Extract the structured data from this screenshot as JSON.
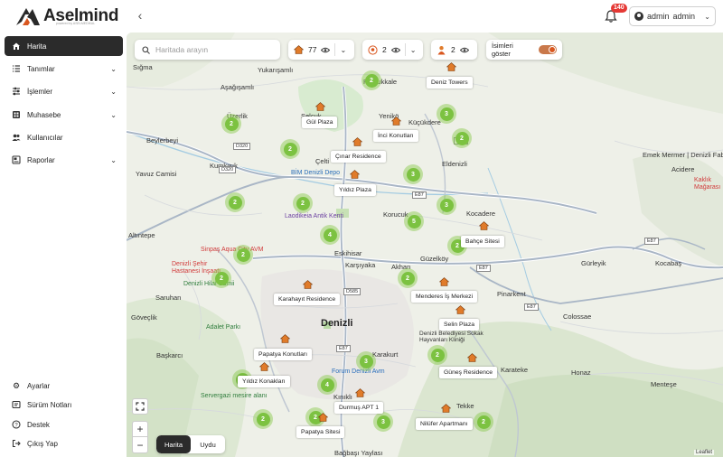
{
  "brand": {
    "name": "Aselmind",
    "sub": "powered by ASELMEDİKAL"
  },
  "header": {
    "notification_count": "140",
    "user_first": "admin",
    "user_last": "admin"
  },
  "sidebar": {
    "items": [
      {
        "label": "Harita",
        "icon": "home-icon",
        "active": true
      },
      {
        "label": "Tanımlar",
        "icon": "list-icon",
        "has_children": true
      },
      {
        "label": "İşlemler",
        "icon": "sliders-icon",
        "has_children": true
      },
      {
        "label": "Muhasebe",
        "icon": "calculator-icon",
        "has_children": true
      },
      {
        "label": "Kullanıcılar",
        "icon": "users-icon"
      },
      {
        "label": "Raporlar",
        "icon": "report-icon",
        "has_children": true
      }
    ],
    "bottom_items": [
      {
        "label": "Ayarlar",
        "icon": "gear-icon"
      },
      {
        "label": "Sürüm Notları",
        "icon": "notes-icon"
      },
      {
        "label": "Destek",
        "icon": "help-icon"
      },
      {
        "label": "Çıkış Yap",
        "icon": "logout-icon"
      }
    ]
  },
  "map": {
    "search_placeholder": "Haritada arayın",
    "filters": [
      {
        "count": "77",
        "icon": "house-icon"
      },
      {
        "count": "2",
        "icon": "pin-badge-icon"
      },
      {
        "count": "2",
        "icon": "person-icon"
      }
    ],
    "toggle_label": "İsimleri göster",
    "layers": [
      "Harita",
      "Uydu"
    ],
    "attribution": "Leaflet",
    "places": [
      {
        "text": "Sığma"
      },
      {
        "text": "Yukarışamlı"
      },
      {
        "text": "Aşağışamlı"
      },
      {
        "text": "Pamukkale"
      },
      {
        "text": "Üzerlik"
      },
      {
        "text": "Beylerbeyi"
      },
      {
        "text": "Yenikö"
      },
      {
        "text": "Küçükdere"
      },
      {
        "text": "Selçuk"
      },
      {
        "text": "Kumkısık"
      },
      {
        "text": "Çelti"
      },
      {
        "text": "Eldenizli"
      },
      {
        "text": "Emek Mermer | Denizli Fabrika"
      },
      {
        "text": "Acidere"
      },
      {
        "text": "Altıntepe"
      },
      {
        "text": "Korucuk"
      },
      {
        "text": "Kocadere"
      },
      {
        "text": "Eskihisar"
      },
      {
        "text": "Karşıyaka"
      },
      {
        "text": "Akhan"
      },
      {
        "text": "Güzelköy"
      },
      {
        "text": "Gürleyik"
      },
      {
        "text": "Kocabaş"
      },
      {
        "text": "Saruhan"
      },
      {
        "text": "Pinarkent"
      },
      {
        "text": "Göveçlik"
      },
      {
        "text": "Denizli"
      },
      {
        "text": "Colossae"
      },
      {
        "text": "Başkarcı"
      },
      {
        "text": "Karakurt"
      },
      {
        "text": "Karateke"
      },
      {
        "text": "Honaz"
      },
      {
        "text": "Menteşe"
      },
      {
        "text": "Tekke"
      },
      {
        "text": "Kınıklı"
      },
      {
        "text": "Bağbaşı Yaylası"
      }
    ],
    "pois": [
      {
        "text": "BİM Denizli Depo"
      },
      {
        "text": "Laodikeia Antik Kenti"
      },
      {
        "text": "Sinpaş Aqua City AVM"
      },
      {
        "text": "Denizli Şehir Hastanesi İnşaatı"
      },
      {
        "text": "Denizli Hilal Camii"
      },
      {
        "text": "Adalet Parkı"
      },
      {
        "text": "Forum Denizli Avm"
      },
      {
        "text": "Servergazi mesire alanı"
      },
      {
        "text": "Denizli Belediyesi Sokak Hayvanları Kliniği"
      },
      {
        "text": "Yavuz Camisi"
      },
      {
        "text": "Kaklık Mağarası"
      }
    ],
    "roads": [
      "D320",
      "D320",
      "E87",
      "E87",
      "D585",
      "E87",
      "E87",
      "E87",
      "E87"
    ],
    "clusters": [
      "2",
      "2",
      "2",
      "3",
      "2",
      "2",
      "3",
      "2",
      "3",
      "5",
      "2",
      "2",
      "4",
      "2",
      "2",
      "3",
      "2",
      "4",
      "2",
      "2",
      "2",
      "3",
      "2"
    ],
    "properties": [
      "Deniz Towers",
      "Gül Plaza",
      "İnci Konutları",
      "Çınar Residence",
      "Yıldız Plaza",
      "Bahçe Sitesi",
      "Karahayıt Residence",
      "Menderes İş Merkezi",
      "Selin Plaza",
      "Papatya Konutları",
      "Yıldız Konakları",
      "Güneş Residence",
      "Durmuş APT 1",
      "Nilüfer Apartmanı",
      "Papatya Sitesi"
    ]
  }
}
